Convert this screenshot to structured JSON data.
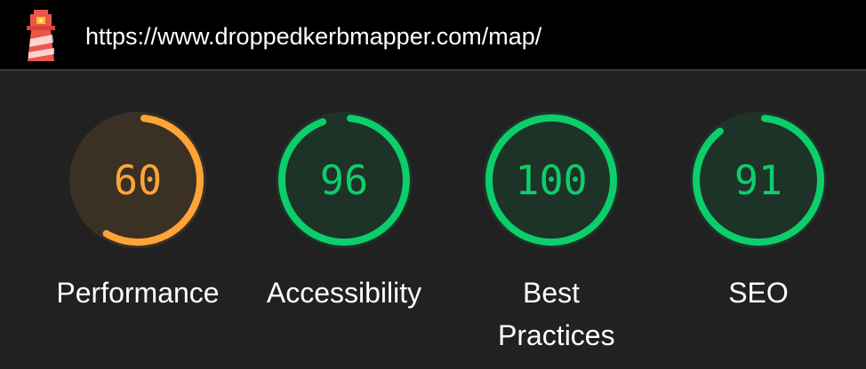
{
  "header": {
    "url": "https://www.droppedkerbmapper.com/map/",
    "logo_icon": "lighthouse-icon"
  },
  "colors": {
    "average": "#ffa436",
    "average_bg": "#3a3024",
    "pass": "#0cce6b",
    "pass_bg": "#1e3328",
    "track": "#2d2d2d"
  },
  "gauges": [
    {
      "score": "60",
      "value": 60,
      "label": "Performance",
      "status": "average"
    },
    {
      "score": "96",
      "value": 96,
      "label": "Accessibility",
      "status": "pass"
    },
    {
      "score": "100",
      "value": 100,
      "label": "Best Practices",
      "status": "pass"
    },
    {
      "score": "91",
      "value": 91,
      "label": "SEO",
      "status": "pass"
    }
  ]
}
